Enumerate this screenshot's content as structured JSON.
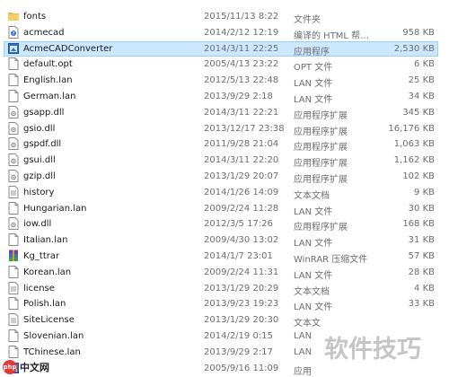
{
  "files": [
    {
      "name": "fonts",
      "date": "2015/11/13 8:22",
      "type": "文件夹",
      "size": "",
      "icon": "folder-icon"
    },
    {
      "name": "acmecad",
      "date": "2014/2/12 12:19",
      "type": "编译的 HTML 帮…",
      "size": "958 KB",
      "icon": "chm-help-icon"
    },
    {
      "name": "AcmeCADConverter",
      "date": "2014/3/11 22:25",
      "type": "应用程序",
      "size": "2,530 KB",
      "icon": "app-icon",
      "selected": true
    },
    {
      "name": "default.opt",
      "date": "2005/4/13 23:22",
      "type": "OPT 文件",
      "size": "6 KB",
      "icon": "file-icon"
    },
    {
      "name": "English.lan",
      "date": "2012/5/13 22:48",
      "type": "LAN 文件",
      "size": "25 KB",
      "icon": "file-icon"
    },
    {
      "name": "German.lan",
      "date": "2013/9/29 2:18",
      "type": "LAN 文件",
      "size": "34 KB",
      "icon": "file-icon"
    },
    {
      "name": "gsapp.dll",
      "date": "2014/3/11 22:21",
      "type": "应用程序扩展",
      "size": "345 KB",
      "icon": "dll-icon"
    },
    {
      "name": "gsio.dll",
      "date": "2013/12/17 23:38",
      "type": "应用程序扩展",
      "size": "16,176 KB",
      "icon": "dll-icon"
    },
    {
      "name": "gspdf.dll",
      "date": "2011/9/28 21:04",
      "type": "应用程序扩展",
      "size": "1,063 KB",
      "icon": "dll-icon"
    },
    {
      "name": "gsui.dll",
      "date": "2014/3/11 22:20",
      "type": "应用程序扩展",
      "size": "1,162 KB",
      "icon": "dll-icon"
    },
    {
      "name": "gzip.dll",
      "date": "2013/1/29 20:07",
      "type": "应用程序扩展",
      "size": "102 KB",
      "icon": "dll-icon"
    },
    {
      "name": "history",
      "date": "2014/1/26 14:09",
      "type": "文本文档",
      "size": "9 KB",
      "icon": "text-file-icon"
    },
    {
      "name": "Hungarian.lan",
      "date": "2009/2/24 11:28",
      "type": "LAN 文件",
      "size": "30 KB",
      "icon": "file-icon"
    },
    {
      "name": "iow.dll",
      "date": "2012/3/5 17:26",
      "type": "应用程序扩展",
      "size": "168 KB",
      "icon": "dll-icon"
    },
    {
      "name": "Italian.lan",
      "date": "2009/4/30 13:02",
      "type": "LAN 文件",
      "size": "31 KB",
      "icon": "file-icon"
    },
    {
      "name": "Kg_ttrar",
      "date": "2014/1/7 23:01",
      "type": "WinRAR 压缩文件",
      "size": "57 KB",
      "icon": "winrar-icon"
    },
    {
      "name": "Korean.lan",
      "date": "2009/2/24 11:31",
      "type": "LAN 文件",
      "size": "28 KB",
      "icon": "file-icon"
    },
    {
      "name": "license",
      "date": "2013/1/29 20:29",
      "type": "文本文档",
      "size": "4 KB",
      "icon": "text-file-icon"
    },
    {
      "name": "Polish.lan",
      "date": "2013/9/23 19:23",
      "type": "LAN 文件",
      "size": "33 KB",
      "icon": "file-icon"
    },
    {
      "name": "SiteLicense",
      "date": "2013/1/29 20:30",
      "type": "文本文",
      "size": "",
      "icon": "text-file-icon"
    },
    {
      "name": "Slovenian.lan",
      "date": "2014/2/19 0:15",
      "type": "LAN",
      "size": "",
      "icon": "file-icon"
    },
    {
      "name": "TChinese.lan",
      "date": "2013/9/29 2:17",
      "type": "LAN",
      "size": "",
      "icon": "file-icon"
    },
    {
      "name": "",
      "date": "2005/9/16 11:09",
      "type": "应用",
      "size": "",
      "icon": "app-icon"
    }
  ],
  "watermark": "软件技巧",
  "logo": {
    "badge": "php",
    "text": "中文网"
  },
  "colors": {
    "selection": "#cce8ff",
    "selection_border": "#99d1ff",
    "folder": "#e8b93f"
  }
}
